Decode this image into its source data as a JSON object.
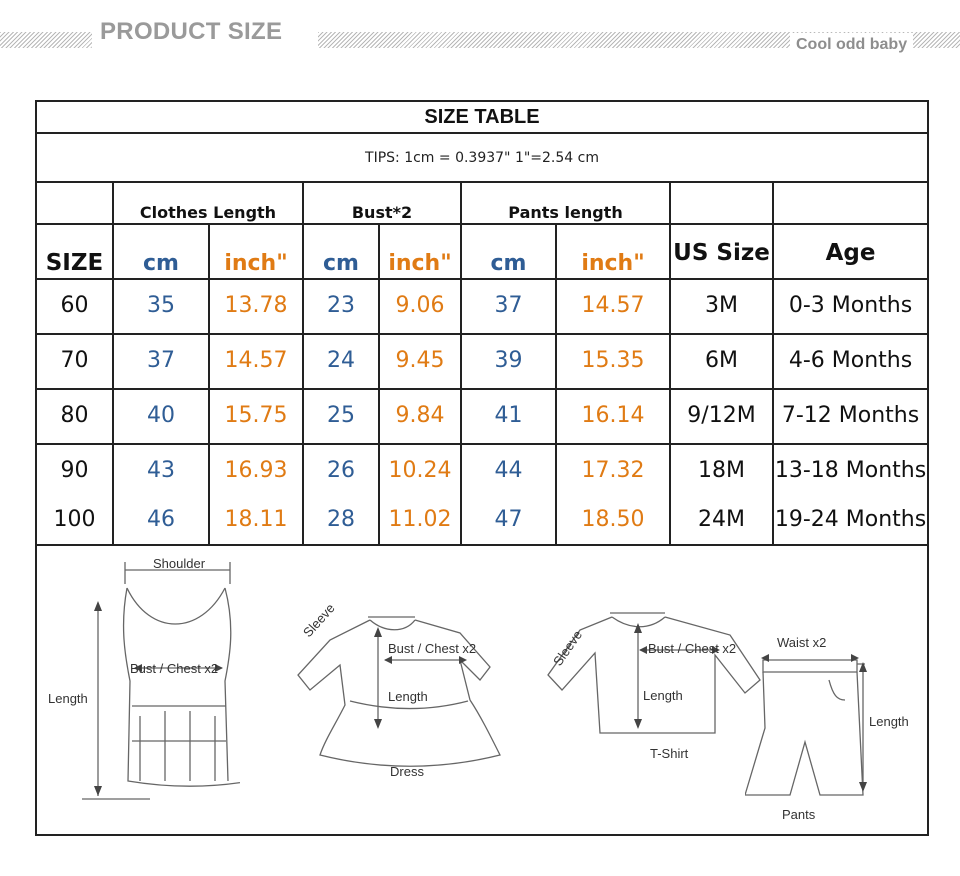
{
  "header": {
    "title": "PRODUCT SIZE",
    "brand": "Cool odd baby"
  },
  "table": {
    "title": "SIZE TABLE",
    "tips": "TIPS: 1cm = 0.3937\"   1\"=2.54 cm",
    "groups": {
      "clothes_length": "Clothes Length",
      "bust": "Bust*2",
      "pants_length": "Pants length"
    },
    "units": {
      "cm": "cm",
      "inch": "inch\""
    },
    "columns": {
      "size": "SIZE",
      "us_size": "US Size",
      "age": "Age"
    },
    "colors": {
      "cm": "#2f5d95",
      "inch": "#e07b14",
      "text": "#111111"
    },
    "rows": [
      {
        "size": "60",
        "cl_cm": "35",
        "cl_in": "13.78",
        "b_cm": "23",
        "b_in": "9.06",
        "p_cm": "37",
        "p_in": "14.57",
        "us": "3M",
        "age": "0-3 Months"
      },
      {
        "size": "70",
        "cl_cm": "37",
        "cl_in": "14.57",
        "b_cm": "24",
        "b_in": "9.45",
        "p_cm": "39",
        "p_in": "15.35",
        "us": "6M",
        "age": "4-6 Months"
      },
      {
        "size": "80",
        "cl_cm": "40",
        "cl_in": "15.75",
        "b_cm": "25",
        "b_in": "9.84",
        "p_cm": "41",
        "p_in": "16.14",
        "us": "9/12M",
        "age": "7-12 Months"
      },
      {
        "size": "90",
        "cl_cm": "43",
        "cl_in": "16.93",
        "b_cm": "26",
        "b_in": "10.24",
        "p_cm": "44",
        "p_in": "17.32",
        "us": "18M",
        "age": "13-18 Months"
      },
      {
        "size": "100",
        "cl_cm": "46",
        "cl_in": "18.11",
        "b_cm": "28",
        "b_in": "11.02",
        "p_cm": "47",
        "p_in": "18.50",
        "us": "24M",
        "age": "19-24 Months"
      }
    ]
  },
  "diagrams": {
    "vest": {
      "shoulder": "Shoulder",
      "bust": "Bust / Chest x2",
      "length": "Length"
    },
    "dress": {
      "sleeve": "Sleeve",
      "bust": "Bust / Chest x2",
      "length": "Length",
      "caption": "Dress"
    },
    "tshirt": {
      "sleeve": "Sleeve",
      "bust": "Bust / Chest x2",
      "length": "Length",
      "caption": "T-Shirt"
    },
    "pants": {
      "waist": "Waist x2",
      "length": "Length",
      "caption": "Pants"
    }
  }
}
